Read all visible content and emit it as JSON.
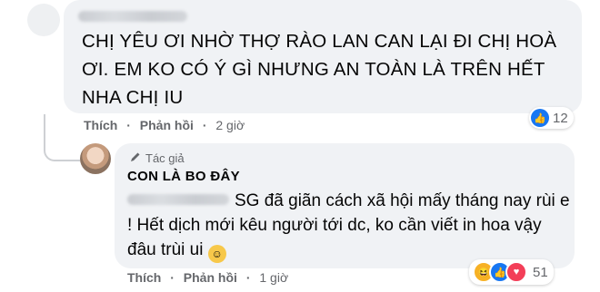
{
  "comment1": {
    "text": "CHỊ YÊU ƠI NHỜ THỢ RÀO LAN CAN LẠI ĐI CHỊ HOÀ ƠI. EM KO CÓ Ý GÌ NHƯNG AN TOÀN LÀ TRÊN HẾT NHA CHỊ IU",
    "like_label": "Thích",
    "reply_label": "Phản hồi",
    "time": "2 giờ",
    "reaction_count": "12",
    "reaction_icons": [
      "like-icon"
    ]
  },
  "comment2": {
    "author_badge": "Tác giả",
    "author_name": "CON LÀ BO ĐÂY",
    "text": "SG đã giãn cách xã hội mấy tháng nay rùi e ! Hết dịch mới kêu người tới dc, ko cần viết in hoa vậy đâu trùi ui",
    "emoji": "smiling-face-icon",
    "like_label": "Thích",
    "reply_label": "Phản hồi",
    "time": "1 giờ",
    "reaction_count": "51",
    "reaction_icons": [
      "haha-icon",
      "like-icon",
      "love-icon"
    ]
  },
  "colors": {
    "bubble": "#f0f2f5",
    "link": "#65676b",
    "like": "#1877f2",
    "love": "#f33e58",
    "haha": "#f7b125"
  }
}
